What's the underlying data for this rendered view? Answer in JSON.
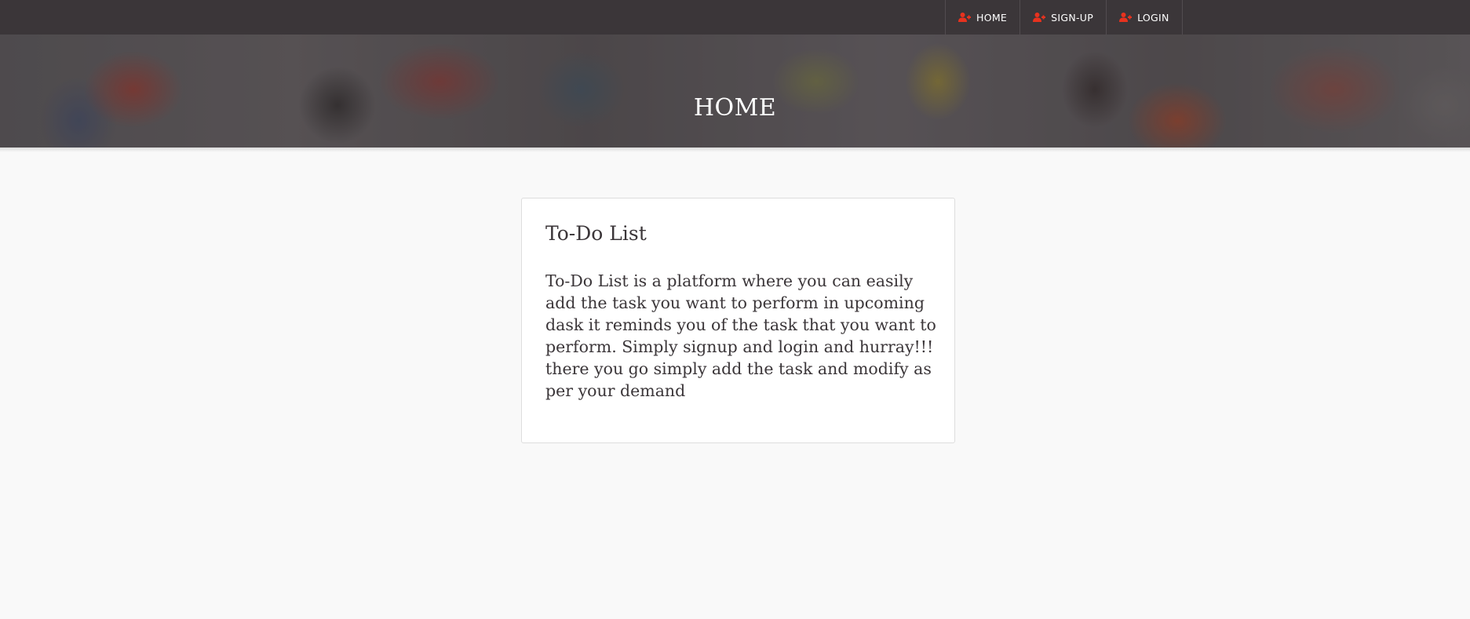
{
  "nav": {
    "items": [
      {
        "label": "HOME",
        "icon": "user-plus-icon"
      },
      {
        "label": "SIGN-UP",
        "icon": "user-plus-icon"
      },
      {
        "label": "LOGIN",
        "icon": "user-plus-icon"
      }
    ],
    "icon_color": "#e8321e",
    "background": "#3b3639"
  },
  "hero": {
    "title": "HOME"
  },
  "card": {
    "title": "To-Do List",
    "body": "To-Do List is a platform where you can easily add the task you want to perform in upcoming dask it reminds you of the task that you want to perform. Simply signup and login and hurray!!! there you go simply add the task and modify as per your demand"
  }
}
